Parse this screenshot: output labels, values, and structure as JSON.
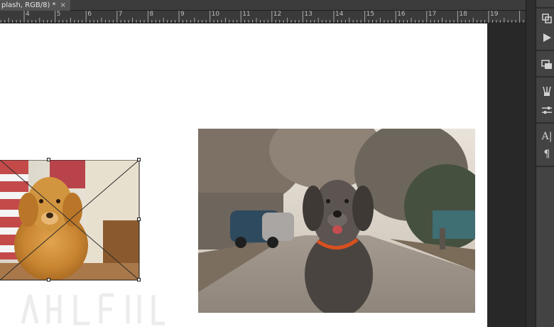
{
  "document_tab": {
    "title": "plash, RGB/8) *",
    "close_glyph": "×"
  },
  "ruler": {
    "labels": [
      "4",
      "5",
      "6",
      "7",
      "8",
      "9",
      "10",
      "11",
      "12",
      "13",
      "14",
      "15",
      "16",
      "17",
      "18",
      "19"
    ]
  },
  "panel_dock": {
    "icons": [
      "history-icon",
      "play-actions-icon",
      "layer-comps-icon",
      "brush-presets-icon",
      "adjustments-icon",
      "character-icon",
      "paragraph-icon"
    ]
  },
  "canvas": {
    "images": [
      {
        "name": "golden-retriever-photo",
        "state": "placed-transform"
      },
      {
        "name": "shaggy-dog-photo",
        "state": "placed"
      }
    ]
  }
}
